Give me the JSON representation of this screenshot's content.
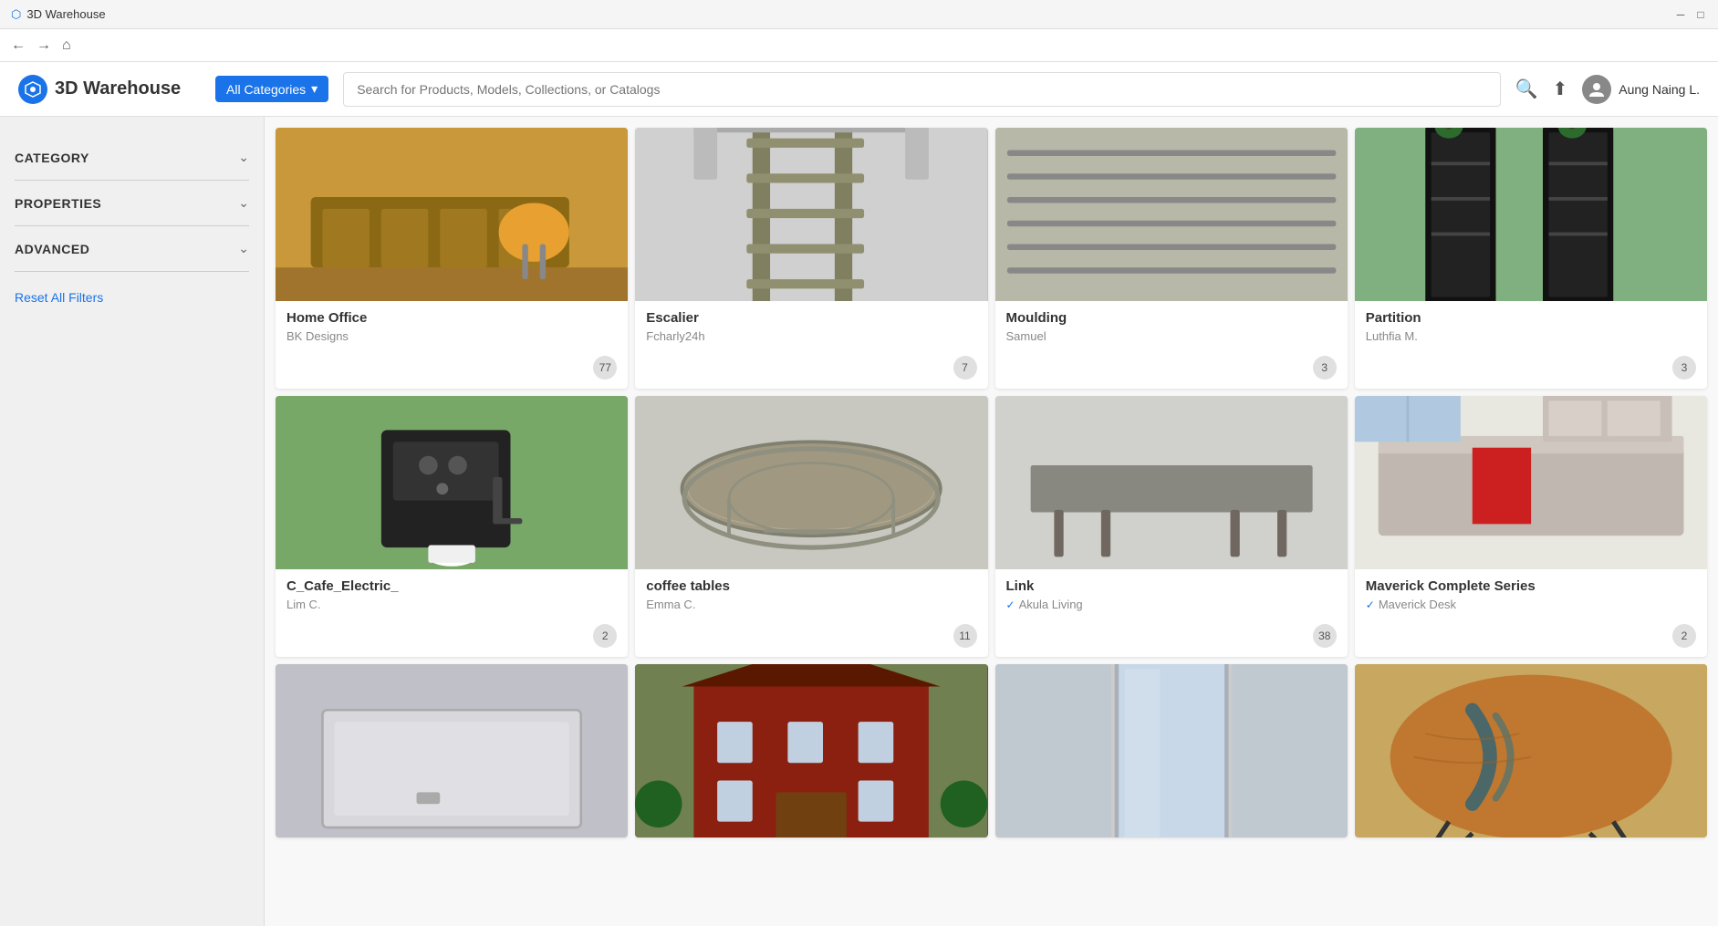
{
  "titleBar": {
    "appName": "3D Warehouse",
    "iconSymbol": "⬡"
  },
  "navBar": {
    "backLabel": "←",
    "forwardLabel": "→",
    "homeLabel": "⌂"
  },
  "header": {
    "logoText": "3D Warehouse",
    "categoryDropdown": {
      "label": "All Categories",
      "chevron": "▾"
    },
    "searchPlaceholder": "Search for Products, Models, Collections, or Catalogs",
    "userIcon": "👤",
    "userName": "Aung Naing L."
  },
  "sidebar": {
    "filters": [
      {
        "id": "category",
        "label": "CATEGORY"
      },
      {
        "id": "properties",
        "label": "PROPERTIES"
      },
      {
        "id": "advanced",
        "label": "ADVANCED"
      }
    ],
    "resetLabel": "Reset All Filters"
  },
  "grid": {
    "items": [
      {
        "id": "home-office",
        "title": "Home Office",
        "author": "BK Designs",
        "verified": false,
        "count": "77",
        "imgClass": "img-home-office",
        "bgColor": "#c8a050"
      },
      {
        "id": "escalier",
        "title": "Escalier",
        "author": "Fcharly24h",
        "verified": false,
        "count": "7",
        "imgClass": "img-escalier",
        "bgColor": "#c0c0c0"
      },
      {
        "id": "moulding",
        "title": "Moulding",
        "author": "Samuel",
        "verified": false,
        "count": "3",
        "imgClass": "img-moulding",
        "bgColor": "#b0b0a0"
      },
      {
        "id": "partition",
        "title": "Partition",
        "author": "Luthfia M.",
        "verified": false,
        "count": "3",
        "imgClass": "img-partition",
        "bgColor": "#80b080"
      },
      {
        "id": "cafe-electric",
        "title": "C_Cafe_Electric_",
        "author": "Lim C.",
        "verified": false,
        "count": "2",
        "imgClass": "img-cafe",
        "bgColor": "#78a870"
      },
      {
        "id": "coffee-tables",
        "title": "coffee tables",
        "author": "Emma C.",
        "verified": false,
        "count": "11",
        "imgClass": "img-coffee-tables",
        "bgColor": "#c8c8c0"
      },
      {
        "id": "link",
        "title": "Link",
        "author": "Akula Living",
        "verified": true,
        "count": "38",
        "imgClass": "img-link",
        "bgColor": "#d0d0cc"
      },
      {
        "id": "maverick",
        "title": "Maverick Complete Series",
        "author": "Maverick Desk",
        "verified": true,
        "count": "2",
        "imgClass": "img-maverick",
        "bgColor": "#e0e0e0"
      },
      {
        "id": "shower",
        "title": "",
        "author": "",
        "verified": false,
        "count": "",
        "imgClass": "img-shower",
        "bgColor": "#c0c0c8"
      },
      {
        "id": "building",
        "title": "",
        "author": "",
        "verified": false,
        "count": "",
        "imgClass": "img-building",
        "bgColor": "#903020"
      },
      {
        "id": "mirror",
        "title": "",
        "author": "",
        "verified": false,
        "count": "",
        "imgClass": "img-mirror",
        "bgColor": "#b8c0c8"
      },
      {
        "id": "wood-table",
        "title": "",
        "author": "",
        "verified": false,
        "count": "",
        "imgClass": "img-table",
        "bgColor": "#c8a060"
      }
    ]
  }
}
